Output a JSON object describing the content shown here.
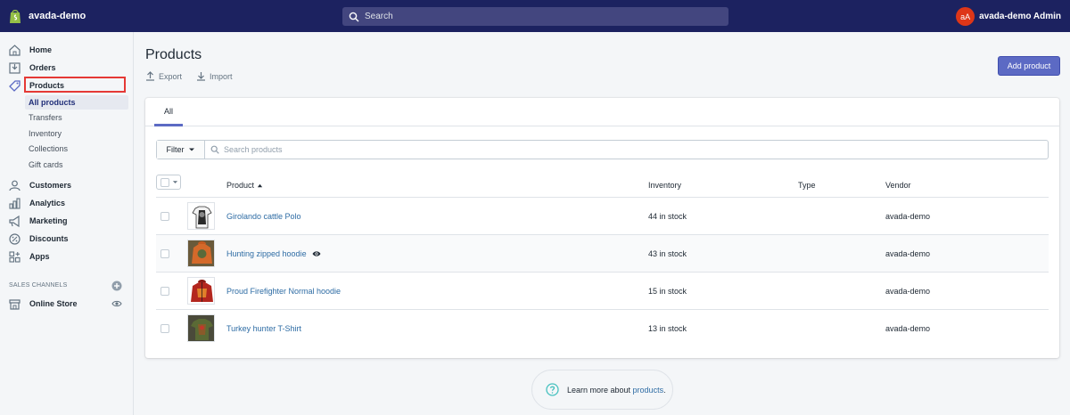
{
  "topbar": {
    "store_name": "avada-demo",
    "search_placeholder": "Search",
    "avatar_initials": "aA",
    "account_name": "avada-demo Admin"
  },
  "sidebar": {
    "items": [
      {
        "label": "Home",
        "icon": "home-icon"
      },
      {
        "label": "Orders",
        "icon": "orders-icon"
      },
      {
        "label": "Products",
        "icon": "tag-icon"
      },
      {
        "label": "Customers",
        "icon": "customers-icon"
      },
      {
        "label": "Analytics",
        "icon": "analytics-icon"
      },
      {
        "label": "Marketing",
        "icon": "megaphone-icon"
      },
      {
        "label": "Discounts",
        "icon": "discount-icon"
      },
      {
        "label": "Apps",
        "icon": "apps-icon"
      }
    ],
    "sub_items": [
      "All products",
      "Transfers",
      "Inventory",
      "Collections",
      "Gift cards"
    ],
    "sales_channels_title": "SALES CHANNELS",
    "online_store": "Online Store"
  },
  "main": {
    "title": "Products",
    "export_label": "Export",
    "import_label": "Import",
    "add_button": "Add product",
    "tab_all": "All",
    "filter_label": "Filter",
    "search_placeholder": "Search products",
    "columns": {
      "product": "Product",
      "inventory": "Inventory",
      "type": "Type",
      "vendor": "Vendor"
    },
    "rows": [
      {
        "name": "Girolando cattle Polo",
        "inventory": "44 in stock",
        "type": "",
        "vendor": "avada-demo"
      },
      {
        "name": "Hunting zipped hoodie",
        "inventory": "43 in stock",
        "type": "",
        "vendor": "avada-demo"
      },
      {
        "name": "Proud Firefighter Normal hoodie",
        "inventory": "15 in stock",
        "type": "",
        "vendor": "avada-demo"
      },
      {
        "name": "Turkey hunter T-Shirt",
        "inventory": "13 in stock",
        "type": "",
        "vendor": "avada-demo"
      }
    ],
    "learn_prefix": "Learn more about ",
    "learn_link": "products",
    "learn_suffix": "."
  },
  "colors": {
    "topbar": "#1c2260",
    "accent": "#5c6ac4",
    "link": "#2e6ca4",
    "highlight": "#e53935"
  }
}
